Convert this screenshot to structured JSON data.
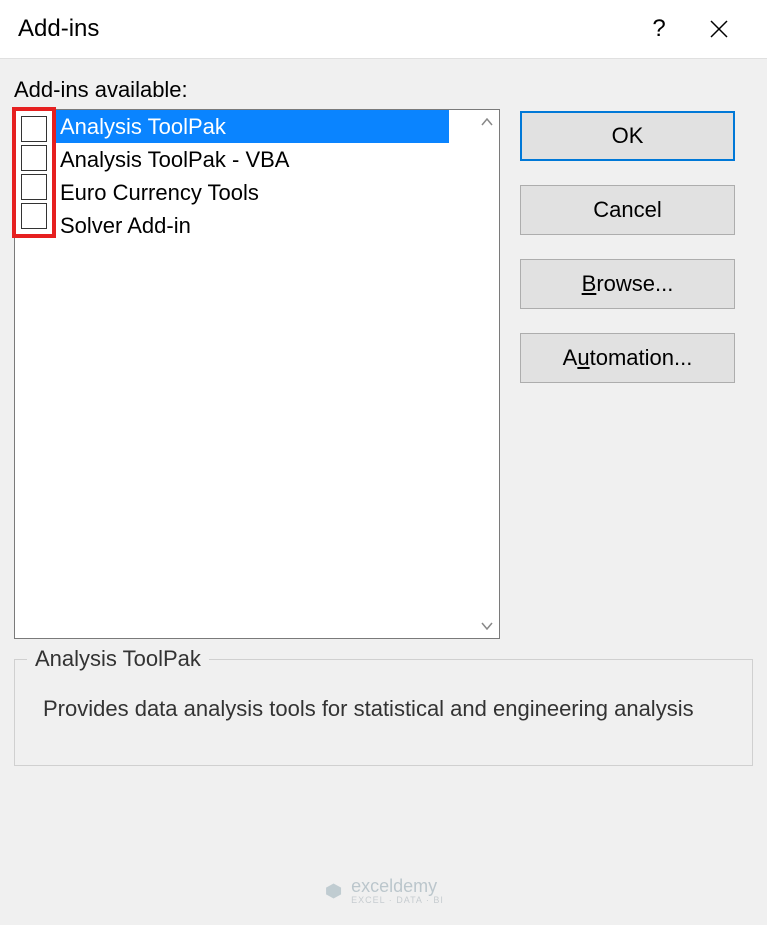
{
  "titlebar": {
    "title": "Add-ins"
  },
  "section_label": "Add-ins available:",
  "addins": [
    {
      "label": "Analysis ToolPak",
      "selected": true
    },
    {
      "label": "Analysis ToolPak - VBA",
      "selected": false
    },
    {
      "label": "Euro Currency Tools",
      "selected": false
    },
    {
      "label": "Solver Add-in",
      "selected": false
    }
  ],
  "buttons": {
    "ok": "OK",
    "cancel": "Cancel",
    "browse": "rowse...",
    "browse_prefix": "B",
    "automation": "tomation...",
    "automation_prefix": "A",
    "automation_u": "u"
  },
  "description": {
    "title": "Analysis ToolPak",
    "text": "Provides data analysis tools for statistical and engineering analysis"
  },
  "watermark": {
    "brand": "exceldemy",
    "sub": "EXCEL · DATA · BI"
  }
}
